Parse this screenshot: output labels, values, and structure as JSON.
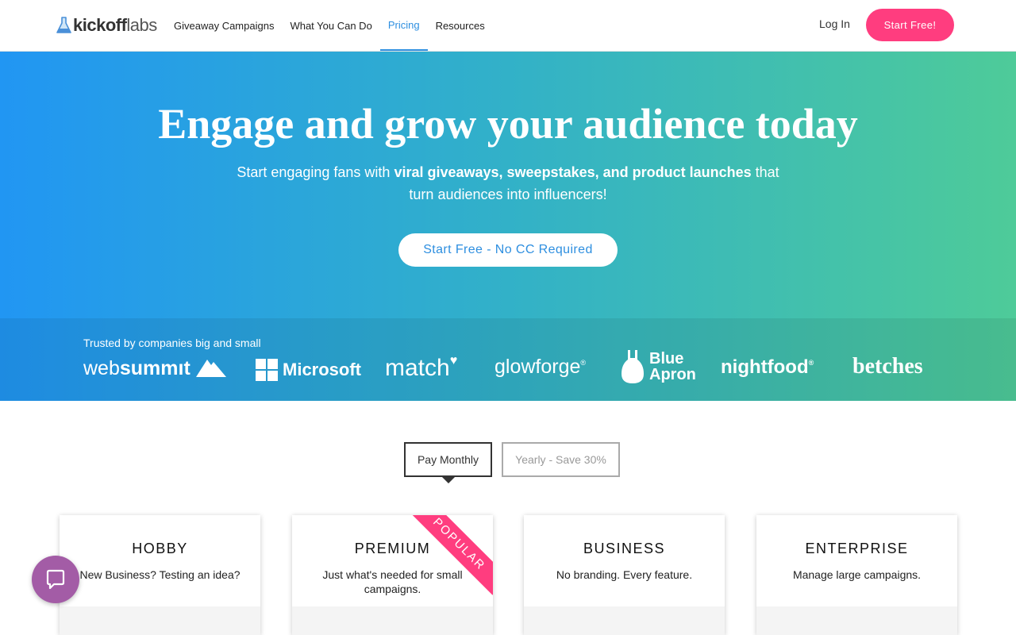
{
  "nav": {
    "logo": {
      "bold": "kickoff",
      "light": "labs"
    },
    "links": [
      {
        "label": "Giveaway Campaigns"
      },
      {
        "label": "What You Can Do"
      },
      {
        "label": "Pricing",
        "active": true
      },
      {
        "label": "Resources"
      }
    ],
    "login_label": "Log In",
    "start_label": "Start Free!"
  },
  "hero": {
    "title": "Engage and grow your audience today",
    "sub_pre": "Start engaging fans with ",
    "sub_bold": "viral giveaways, sweepstakes, and product launches",
    "sub_post": " that turn audiences into influencers!",
    "cta_label": "Start Free - No CC Required"
  },
  "trusted": {
    "label": "Trusted by companies big and small",
    "brands": {
      "websummit_w": "web",
      "websummit_s": "summıt",
      "microsoft": "Microsoft",
      "match": "match",
      "glowforge": "glowforge",
      "glowforge_mark": "®",
      "blueapron_1": "Blue",
      "blueapron_2": "Apron",
      "nightfood": "nightfood",
      "nightfood_mark": "®",
      "betches": "betches"
    }
  },
  "billing": {
    "monthly_label": "Pay Monthly",
    "yearly_label": "Yearly - Save 30%"
  },
  "plans": [
    {
      "name": "HOBBY",
      "desc": "New Business? Testing an idea?"
    },
    {
      "name": "PREMIUM",
      "desc": "Just what's needed for small campaigns.",
      "ribbon": "POPULAR"
    },
    {
      "name": "BUSINESS",
      "desc": "No branding. Every feature."
    },
    {
      "name": "ENTERPRISE",
      "desc": "Manage large campaigns."
    }
  ],
  "colors": {
    "accent_pink": "#ff3d7f",
    "accent_blue": "#2e8fe0",
    "hero_start": "#2196f3",
    "hero_end": "#4ecb99",
    "chat_purple": "#a35ca6"
  },
  "icons": {
    "logo": "rocket-flask-icon",
    "chat": "chat-bubble-icon"
  }
}
